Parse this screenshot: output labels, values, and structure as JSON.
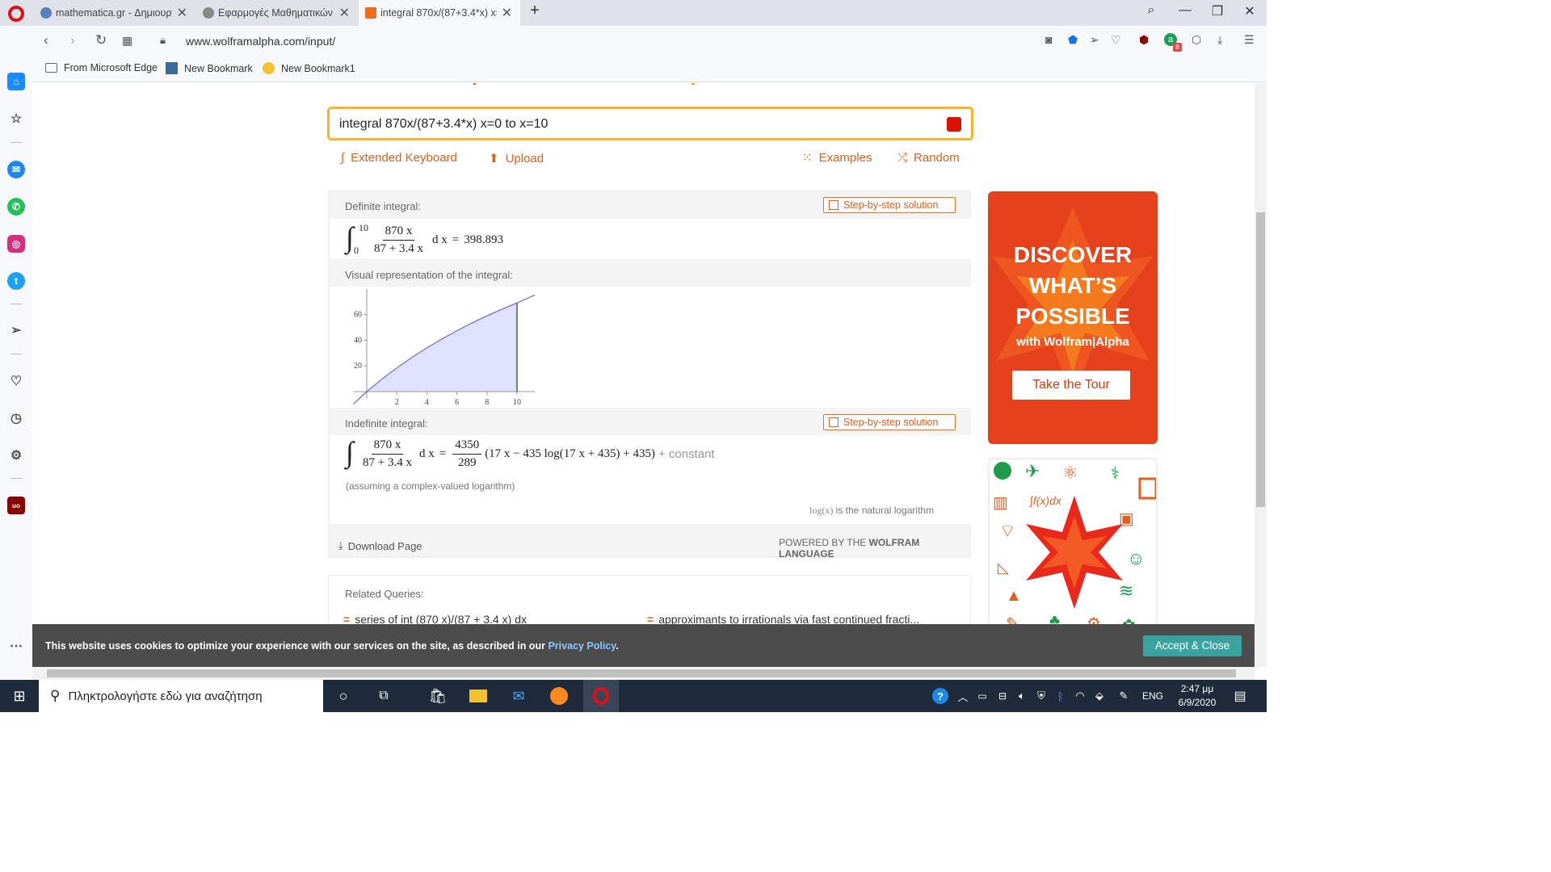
{
  "browser": {
    "tabs": [
      {
        "title": "mathematica.gr - Δημιουργ",
        "active": false
      },
      {
        "title": "Εφαρμογές Μαθηματικών",
        "active": false
      },
      {
        "title": "integral 870x/(87+3.4*x) x=",
        "active": true
      }
    ],
    "url": "www.wolframalpha.com/input/",
    "bookmarks": [
      "From Microsoft Edge",
      "New Bookmark",
      "New Bookmark1"
    ],
    "extension_badge": "8"
  },
  "search": {
    "query": "integral 870x/(87+3.4*x) x=0 to x=10",
    "links": {
      "keyboard": "Extended Keyboard",
      "upload": "Upload",
      "examples": "Examples",
      "random": "Random"
    }
  },
  "result": {
    "definite_title": "Definite integral:",
    "step_label": "Step-by-step solution",
    "definite": {
      "upper": "10",
      "lower": "0",
      "num": "870 x",
      "den": "87 + 3.4 x",
      "dx": "d x",
      "eq": "=",
      "value": "398.893"
    },
    "visual_title": "Visual representation of the integral:",
    "indefinite_title": "Indefinite integral:",
    "indefinite": {
      "num": "870 x",
      "den": "87 + 3.4 x",
      "dx": "d x",
      "eq": "=",
      "cnum": "4350",
      "cden": "289",
      "rest": "(17 x − 435 log(17 x + 435) + 435)",
      "constant": "+ constant"
    },
    "assuming": "(assuming a complex-valued logarithm)",
    "log_note_fn": "log(x)",
    "log_note": "is the natural logarithm",
    "download": "Download Page",
    "powered_prefix": "POWERED BY THE",
    "powered_brand": "WOLFRAM LANGUAGE"
  },
  "chart_data": {
    "type": "area",
    "x": [
      0,
      1,
      2,
      3,
      4,
      5,
      6,
      7,
      8,
      9,
      10
    ],
    "y": [
      0,
      9.62,
      18.44,
      26.55,
      34.04,
      40.97,
      47.41,
      53.4,
      58.98,
      64.2,
      69.1
    ],
    "xticks": [
      "2",
      "4",
      "6",
      "8",
      "10"
    ],
    "yticks": [
      "20",
      "40",
      "60"
    ],
    "fill_color": "#e0e0ff",
    "line_color": "#6b6bd0"
  },
  "ad": {
    "line1": "DISCOVER",
    "line2": "WHAT’S",
    "line3": "POSSIBLE",
    "with": "with Wolfram|Alpha",
    "cta": "Take the Tour"
  },
  "related": {
    "title": "Related Queries:",
    "items": [
      "series of int (870 x)/(87 + 3.4 x) dx",
      "approximants to irrationals via fast continued fracti..."
    ]
  },
  "cookie": {
    "text": "This website uses cookies to optimize your experience with our services on the site, as described in our",
    "link": "Privacy Policy",
    "end": ".",
    "button": "Accept & Close"
  },
  "taskbar": {
    "search_placeholder": "Πληκτρολογήστε εδώ για αναζήτηση",
    "lang": "ENG",
    "time": "2:47 μμ",
    "date": "6/9/2020"
  }
}
